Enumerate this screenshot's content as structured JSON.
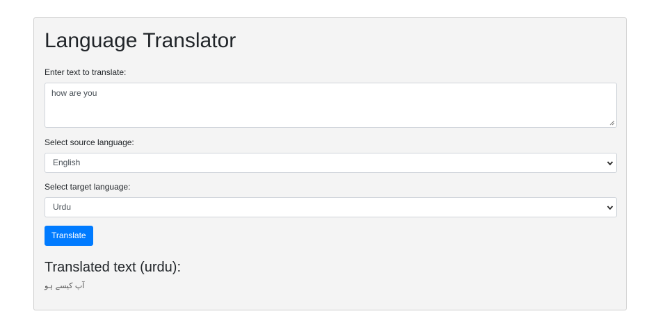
{
  "app": {
    "title": "Language Translator"
  },
  "form": {
    "text_label": "Enter text to translate:",
    "text_value": "how are you",
    "source_label": "Select source language:",
    "source_selected": "English",
    "target_label": "Select target language:",
    "target_selected": "Urdu",
    "translate_button": "Translate"
  },
  "result": {
    "heading": "Translated text (urdu):",
    "text": "آپ کیسے ہو"
  },
  "colors": {
    "accent": "#007bff",
    "card_background": "#f4f4f4",
    "text": "#212529"
  },
  "icons": {
    "dropdown": "chevron-down-icon",
    "resize": "resize-handle-icon"
  }
}
